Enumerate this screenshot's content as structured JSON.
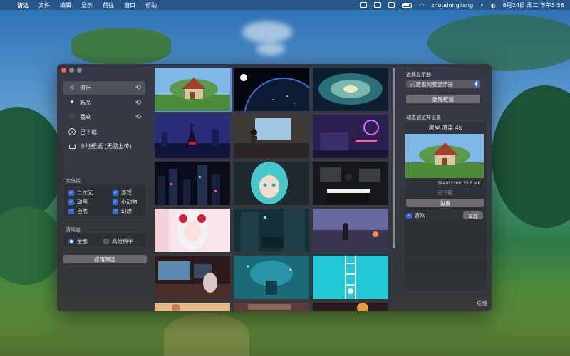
{
  "menubar": {
    "apple_icon": "apple-logo",
    "app_name": "访达",
    "items": [
      "文件",
      "编辑",
      "显示",
      "前往",
      "窗口",
      "帮助"
    ],
    "user": "zhoudongliang",
    "datetime": "8月24日 周二 下午5:56"
  },
  "sidebar": {
    "nav": [
      {
        "label": "流行",
        "icon": "sun-icon",
        "refresh": true,
        "active": true
      },
      {
        "label": "新品",
        "icon": "sparkle-icon",
        "refresh": true,
        "active": false
      },
      {
        "label": "喜欢",
        "icon": "heart-icon",
        "refresh": true,
        "active": false
      },
      {
        "label": "已下载",
        "icon": "download-icon",
        "refresh": false,
        "active": false
      },
      {
        "label": "本地壁纸 (无需上传)",
        "icon": "monitor-icon",
        "refresh": false,
        "active": false
      }
    ],
    "category_title": "大分类",
    "categories": [
      "二次元",
      "游戏",
      "动画",
      "小动物",
      "自然",
      "幻想"
    ],
    "resolution_title": "清晰度",
    "resolution_options": [
      "全部",
      "高分辨率"
    ],
    "resolution_selected": "全部",
    "apply_label": "应用筛选"
  },
  "gallery": {
    "thumbnails": [
      {
        "name": "thumb-house-render",
        "selected": true
      },
      {
        "name": "thumb-earth-night"
      },
      {
        "name": "thumb-galaxy"
      },
      {
        "name": "thumb-anime-city-night"
      },
      {
        "name": "thumb-anime-study-room"
      },
      {
        "name": "thumb-neon-room"
      },
      {
        "name": "thumb-cyberpunk-city"
      },
      {
        "name": "thumb-miku"
      },
      {
        "name": "thumb-piano-girl"
      },
      {
        "name": "thumb-pink-anime-girl"
      },
      {
        "name": "thumb-cyber-alley"
      },
      {
        "name": "thumb-rooftop-sunset"
      },
      {
        "name": "thumb-gaming-desk"
      },
      {
        "name": "thumb-underwater-teal"
      },
      {
        "name": "thumb-cyan-ladder"
      },
      {
        "name": "thumb-partial-1"
      },
      {
        "name": "thumb-partial-2"
      },
      {
        "name": "thumb-partial-3"
      }
    ]
  },
  "right_panel": {
    "display_label": "选择显示器:",
    "display_value": "内建视网膜显示器",
    "delete_label": "删除壁纸",
    "preview_section_label": "动态预览并设置",
    "preview_title": "房屋 渲染 4k",
    "resolution": "3840*2160",
    "size": "35.5 MB",
    "downloaded_label": "已下载",
    "set_label": "设置",
    "like_label": "喜欢",
    "single_label": "单屏",
    "feedback_label": "反馈"
  }
}
